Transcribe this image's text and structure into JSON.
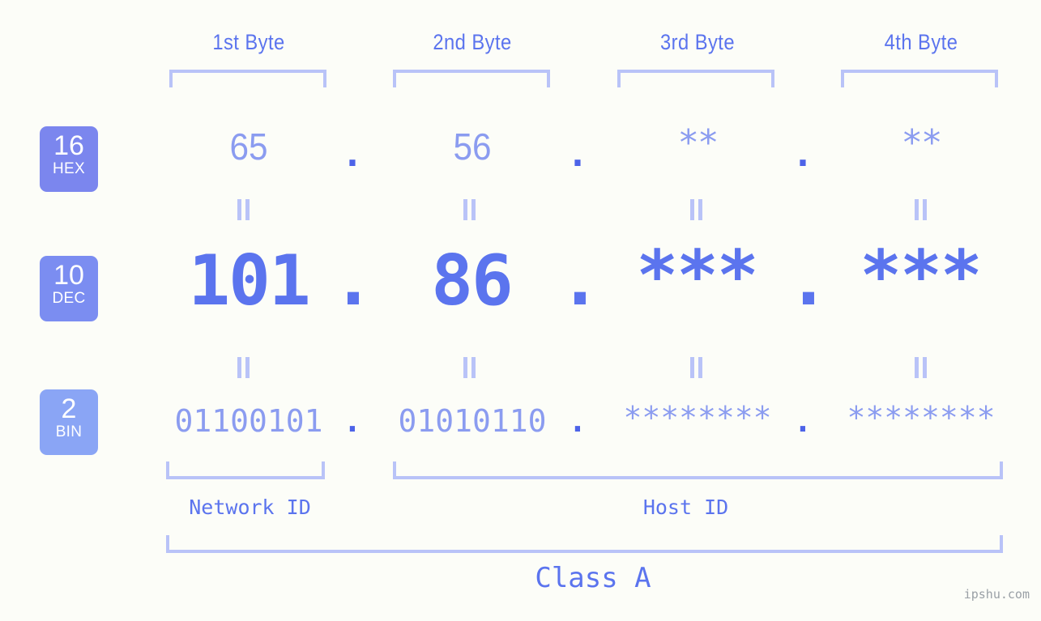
{
  "watermark": "ipshu.com",
  "byte_headers": [
    {
      "label": "1st Byte"
    },
    {
      "label": "2nd Byte"
    },
    {
      "label": "3rd Byte"
    },
    {
      "label": "4th Byte"
    }
  ],
  "bases": [
    {
      "number": "16",
      "name": "HEX",
      "color": "#7b86ee"
    },
    {
      "number": "10",
      "name": "DEC",
      "color": "#7b8df1"
    },
    {
      "number": "2",
      "name": "BIN",
      "color": "#8aa5f5"
    }
  ],
  "rows": {
    "hex": {
      "values": [
        "65",
        "56",
        "**",
        "**"
      ],
      "separator": "."
    },
    "dec": {
      "values": [
        "101",
        "86",
        "***",
        "***"
      ],
      "separator": "."
    },
    "bin": {
      "values": [
        "01100101",
        "01010110",
        "********",
        "********"
      ],
      "separator": "."
    }
  },
  "equals_symbol": "=",
  "sections": [
    {
      "label": "Network ID"
    },
    {
      "label": "Host ID"
    }
  ],
  "class": {
    "label": "Class A"
  },
  "colors": {
    "background": "#fcfdf8",
    "accent": "#5b74ee",
    "accent_light": "#8b9cf0",
    "bracket": "#b9c3f8",
    "dot": "#4d63e8"
  }
}
